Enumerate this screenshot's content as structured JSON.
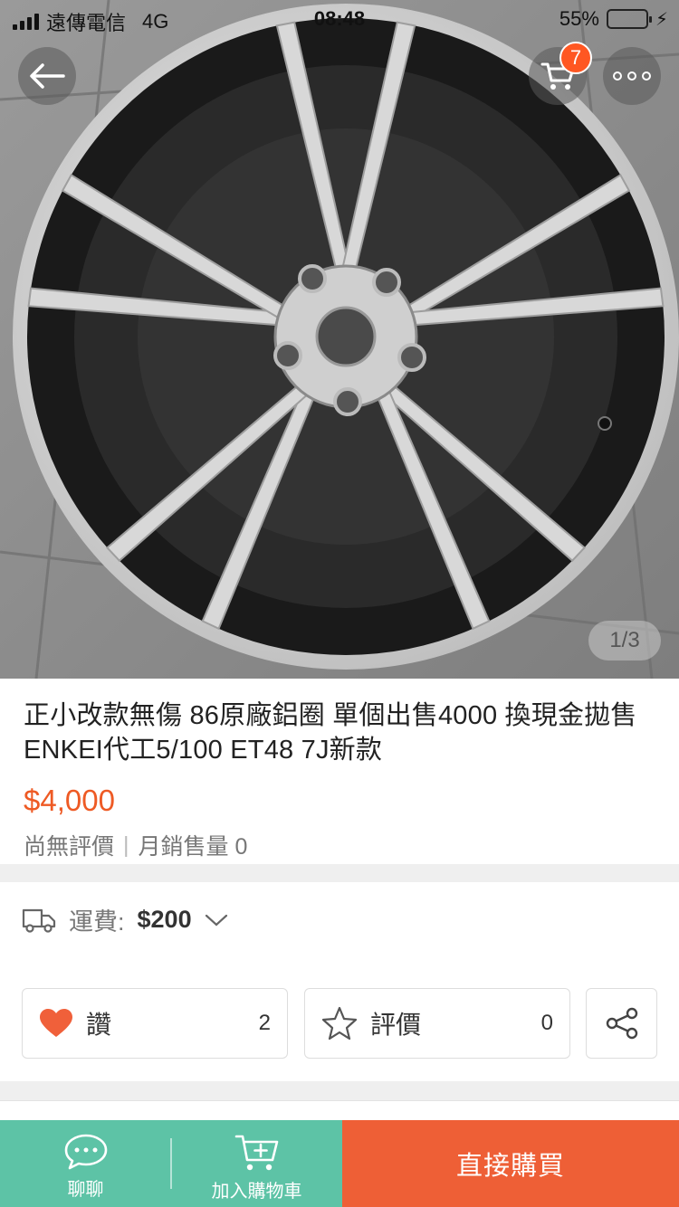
{
  "status_bar": {
    "carrier": "遠傳電信",
    "network": "4G",
    "time": "08:48",
    "battery": "55%",
    "battery_level": 0.55
  },
  "header": {
    "back_icon": "arrow-left-icon",
    "cart_icon": "cart-icon",
    "cart_badge": "7",
    "more_icon": "more-dots-icon"
  },
  "gallery": {
    "pager": "1/3",
    "image_icon": "alloy-wheel-photo"
  },
  "product": {
    "title": "正小改款無傷 86原廠鋁圈 單個出售4000 換現金拋售 ENKEI代工5/100 ET48 7J新款",
    "price": "$4,000",
    "rating_text": "尚無評價",
    "separator": "|",
    "sales_text": "月銷售量 0"
  },
  "shipping": {
    "label": "運費:",
    "value": "$200",
    "icon": "truck-icon"
  },
  "actions": {
    "like_label": "讚",
    "like_count": "2",
    "rate_label": "評價",
    "rate_count": "0",
    "share_icon": "share-icon"
  },
  "bottom_bar": {
    "chat_label": "聊聊",
    "add_cart_label": "加入購物車",
    "buy_label": "直接購買"
  },
  "colors": {
    "accent": "#ee5a24",
    "teal": "#5dc3a6",
    "buy_bg": "#ee5f36",
    "badge": "#ff5722",
    "heart": "#f0603a"
  }
}
